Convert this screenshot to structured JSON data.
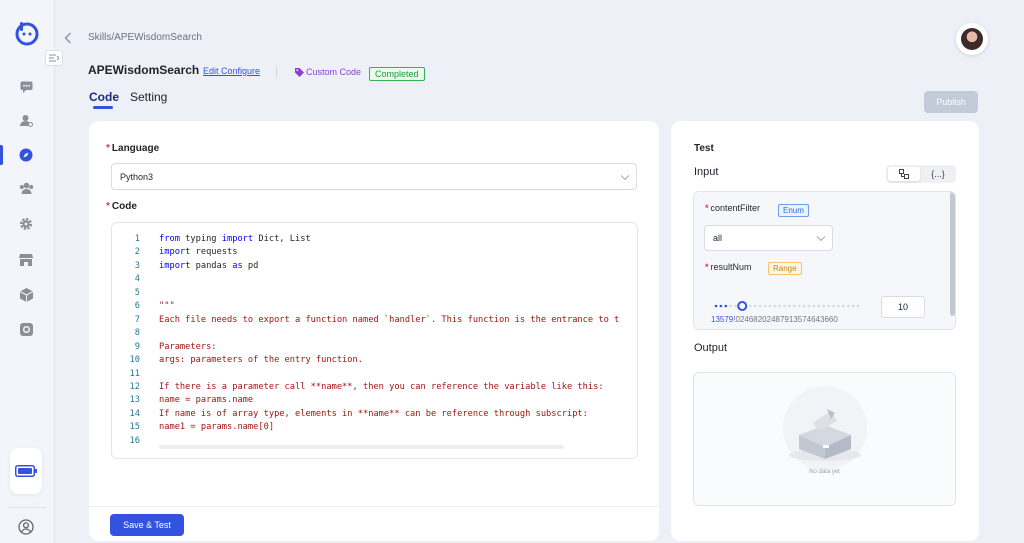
{
  "breadcrumb": "Skills/APEWisdomSearch",
  "header": {
    "title": "APEWisdomSearch",
    "edit_link": "Edit Configure",
    "type_tag": "Custom Code",
    "status": "Completed"
  },
  "tabs": [
    {
      "label": "Code",
      "active": true
    },
    {
      "label": "Setting",
      "active": false
    }
  ],
  "publish_label": "Publish",
  "left_panel": {
    "language_label": "Language",
    "language_value": "Python3",
    "code_label": "Code",
    "save_label": "Save & Test",
    "code_lines": [
      {
        "n": "1",
        "segments": [
          {
            "t": "from",
            "c": "kw"
          },
          {
            "t": " typing ",
            "c": ""
          },
          {
            "t": "import",
            "c": "kw"
          },
          {
            "t": " Dict, List",
            "c": ""
          }
        ]
      },
      {
        "n": "2",
        "segments": [
          {
            "t": "import",
            "c": "kw"
          },
          {
            "t": " requests",
            "c": ""
          }
        ]
      },
      {
        "n": "3",
        "segments": [
          {
            "t": "import",
            "c": "kw"
          },
          {
            "t": " pandas ",
            "c": ""
          },
          {
            "t": "as",
            "c": "kw"
          },
          {
            "t": " pd",
            "c": ""
          }
        ]
      },
      {
        "n": "4",
        "segments": []
      },
      {
        "n": "5",
        "segments": []
      },
      {
        "n": "6",
        "segments": [
          {
            "t": "\"\"\"",
            "c": "str"
          }
        ]
      },
      {
        "n": "7",
        "segments": [
          {
            "t": "Each file needs to export a function named `handler`. This function is the entrance to t",
            "c": "str"
          }
        ]
      },
      {
        "n": "8",
        "segments": []
      },
      {
        "n": "9",
        "segments": [
          {
            "t": "Parameters:",
            "c": "str"
          }
        ]
      },
      {
        "n": "10",
        "segments": [
          {
            "t": "args: parameters of the entry function.",
            "c": "str"
          }
        ]
      },
      {
        "n": "11",
        "segments": []
      },
      {
        "n": "12",
        "segments": [
          {
            "t": "If there is a parameter call **name**, then you can reference the variable like this:",
            "c": "str"
          }
        ]
      },
      {
        "n": "13",
        "segments": [
          {
            "t": "name = params.name",
            "c": "str"
          }
        ]
      },
      {
        "n": "14",
        "segments": [
          {
            "t": "If name is of array type, elements in **name** can be reference through subscript:",
            "c": "str"
          }
        ]
      },
      {
        "n": "15",
        "segments": [
          {
            "t": "name1 = params.name[0]",
            "c": "str"
          }
        ]
      },
      {
        "n": "16",
        "segments": []
      }
    ]
  },
  "right_panel": {
    "test_label": "Test",
    "input_label": "Input",
    "toggle": [
      "⊡",
      "{...}"
    ],
    "params": {
      "content_filter_label": "contentFilter",
      "content_filter_tag": "Enum",
      "content_filter_value": "all",
      "result_num_label": "resultNum",
      "result_num_tag": "Range",
      "result_num_value": "10",
      "slider_fraction": 0.1,
      "slider_ticks_highlight": "13579",
      "slider_ticks_rest": "!02468202487913574643660"
    },
    "output_label": "Output",
    "no_data": "No data yet"
  },
  "colors": {
    "accent": "#3352e0",
    "completed": "#35b14f",
    "custom_code": "#8b3fd6"
  }
}
